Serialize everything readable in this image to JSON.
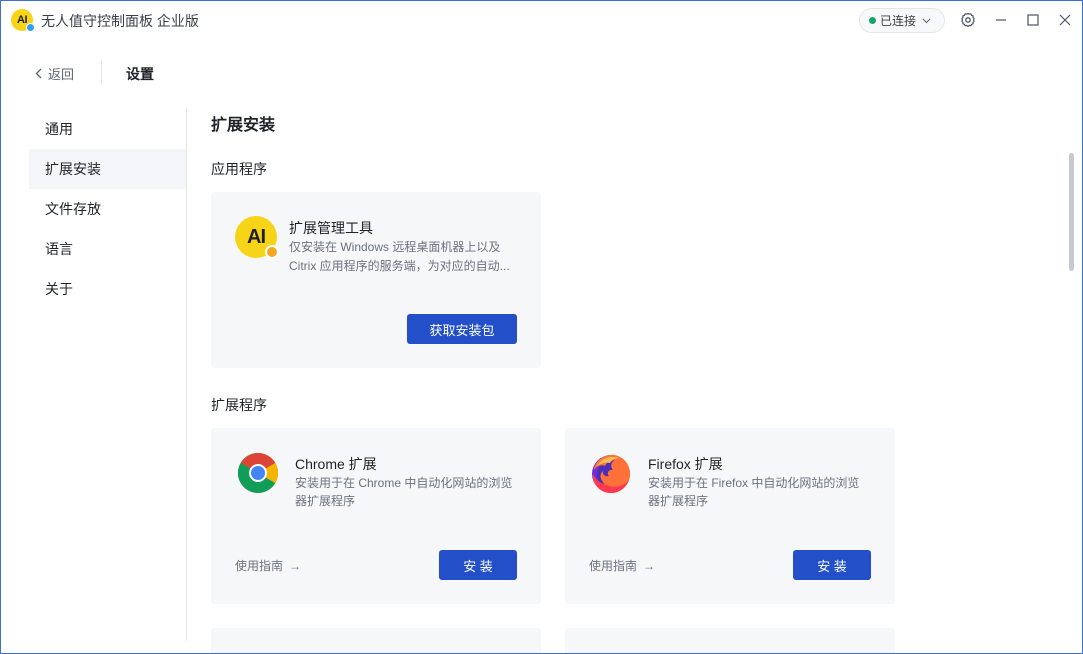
{
  "titlebar": {
    "logo_text": "AI",
    "title": "无人值守控制面板 企业版",
    "status": "已连接",
    "status_color": "#13a36b"
  },
  "header": {
    "back_label": "返回",
    "page_title": "设置"
  },
  "sidebar": {
    "items": [
      {
        "label": "通用"
      },
      {
        "label": "扩展安装"
      },
      {
        "label": "文件存放"
      },
      {
        "label": "语言"
      },
      {
        "label": "关于"
      }
    ]
  },
  "main": {
    "section_title": "扩展安装",
    "apps_group": {
      "label": "应用程序",
      "card": {
        "icon": "ai-extension-tool-icon",
        "title": "扩展管理工具",
        "desc_line1": "仅安装在 Windows 远程桌面机器上以及",
        "desc_line2": "Citrix 应用程序的服务端，为对应的自动...",
        "button_label": "获取安装包"
      }
    },
    "ext_group": {
      "label": "扩展程序",
      "cards": [
        {
          "icon": "chrome-icon",
          "title": "Chrome 扩展",
          "desc_line1": "安装用于在 Chrome 中自动化网站的浏览",
          "desc_line2": "器扩展程序",
          "guide_label": "使用指南",
          "button_label": "安 装"
        },
        {
          "icon": "firefox-icon",
          "title": "Firefox 扩展",
          "desc_line1": "安装用于在 Firefox 中自动化网站的浏览",
          "desc_line2": "器扩展程序",
          "guide_label": "使用指南",
          "button_label": "安 装"
        }
      ]
    }
  },
  "colors": {
    "primary": "#2350c8",
    "accent_yellow": "#f7d417",
    "window_border": "#3d6fd6"
  }
}
